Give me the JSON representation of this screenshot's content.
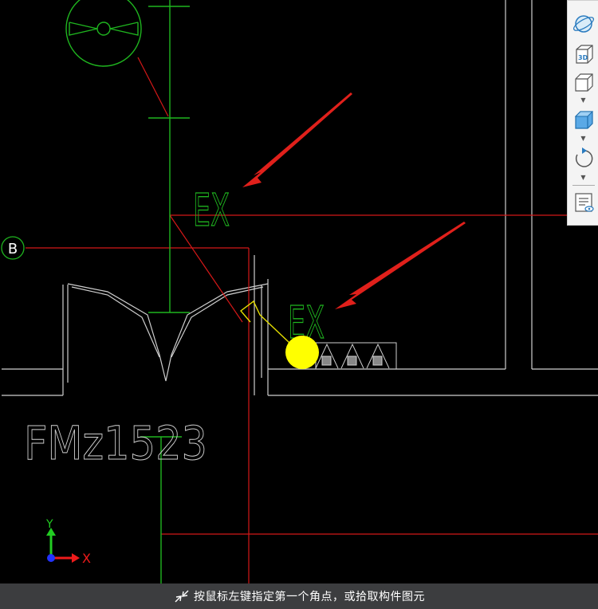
{
  "canvas": {
    "labels": {
      "grid_axis": "B",
      "door_tag": "FMz1523",
      "ex_tag_1": "EX",
      "ex_tag_2": "EX"
    },
    "ucs": {
      "x_label": "X",
      "y_label": "Y"
    },
    "colors": {
      "background": "#000000",
      "wall": "#d0d0d0",
      "axis_line": "#d41818",
      "pipe": "#1fb51f",
      "marker": "#ffff00",
      "arrow": "#e0201b"
    }
  },
  "toolbar": {
    "items": [
      {
        "name": "orbit",
        "icon": "orbit-icon"
      },
      {
        "name": "view-3d",
        "icon": "view-3d-icon",
        "label": "3D"
      },
      {
        "name": "wireframe-view",
        "icon": "wireframe-cube-icon"
      },
      {
        "name": "shaded-view",
        "icon": "shaded-cube-icon"
      },
      {
        "name": "rotate",
        "icon": "rotate-icon"
      },
      {
        "name": "display-settings",
        "icon": "layer-display-icon"
      }
    ]
  },
  "status": {
    "prompt": "按鼠标左键指定第一个角点，或拾取构件图元",
    "icon": "select-corner-icon"
  }
}
